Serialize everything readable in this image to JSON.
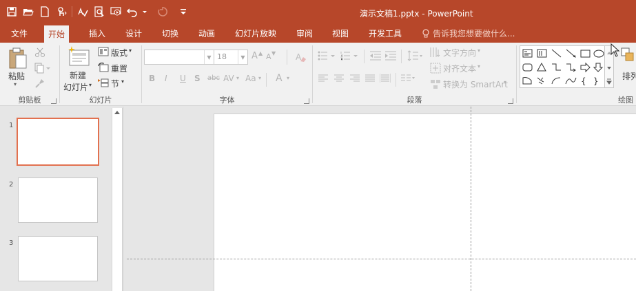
{
  "window": {
    "title": "演示文稿1.pptx - PowerPoint"
  },
  "quick_access": [
    "save-icon",
    "open-icon",
    "new-icon",
    "touch-mode-icon",
    "spelling-icon",
    "print-preview-icon",
    "from-beginning-icon",
    "undo-icon",
    "redo-icon",
    "customize-icon"
  ],
  "tabs": [
    {
      "label": "文件"
    },
    {
      "label": "开始"
    },
    {
      "label": "插入"
    },
    {
      "label": "设计"
    },
    {
      "label": "切换"
    },
    {
      "label": "动画"
    },
    {
      "label": "幻灯片放映"
    },
    {
      "label": "审阅"
    },
    {
      "label": "视图"
    },
    {
      "label": "开发工具"
    }
  ],
  "active_tab": "开始",
  "tell_me": "告诉我您想要做什么...",
  "ribbon": {
    "clipboard": {
      "label": "剪贴板",
      "paste": "粘贴"
    },
    "slides": {
      "label": "幻灯片",
      "new_slide_line1": "新建",
      "new_slide_line2": "幻灯片",
      "layout": "版式",
      "reset": "重置",
      "section": "节"
    },
    "font": {
      "label": "字体",
      "font_name": "",
      "font_size": "18",
      "bold": "B",
      "italic": "I",
      "underline": "U",
      "shadow": "S",
      "strike": "abc",
      "spacing": "AV",
      "case": "Aa",
      "color": "A",
      "grow": "A",
      "shrink": "A"
    },
    "paragraph": {
      "label": "段落",
      "text_direction": "文字方向",
      "align_text": "对齐文本",
      "smartart": "转换为 SmartArt"
    },
    "drawing": {
      "label": "绘图",
      "arrange": "排列"
    }
  },
  "slides_pane": {
    "items": [
      {
        "num": "1"
      },
      {
        "num": "2"
      },
      {
        "num": "3"
      }
    ]
  },
  "colors": {
    "accent": "#b7472a",
    "selected_border": "#e2714f"
  }
}
